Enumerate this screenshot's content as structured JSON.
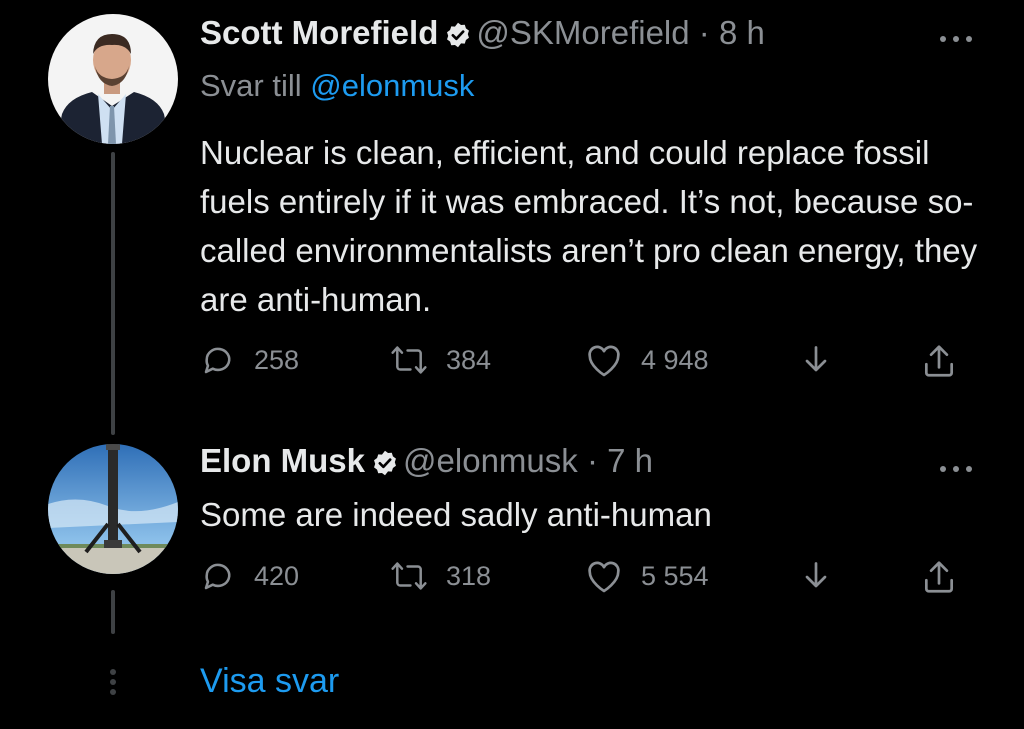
{
  "colors": {
    "background": "#000000",
    "text": "#e7e9ea",
    "muted": "#8b8f94",
    "link": "#1d9bf0",
    "thread_line": "#3e4144"
  },
  "tweets": [
    {
      "name": "Scott Morefield",
      "handle": "@SKMorefield",
      "time": "· 8 h",
      "reply_label": "Svar till",
      "reply_mention": "@elonmusk",
      "text": "Nuclear is clean, efficient, and could replace fossil fuels entirely if it was embraced. It’s not, because so-called environmentalists aren’t pro clean energy, they are anti-human.",
      "replies": "258",
      "retweets": "384",
      "likes": "4 948",
      "more_icon": "more-horizontal-icon",
      "avatar": "profile-photo-man-in-suit"
    },
    {
      "name": "Elon Musk",
      "handle": "@elonmusk",
      "time": "· 7 h",
      "text": "Some are indeed sadly anti-human",
      "replies": "420",
      "retweets": "318",
      "likes": "5 554",
      "more_icon": "more-horizontal-icon",
      "avatar": "profile-photo-rocket-on-landing-pad"
    }
  ],
  "show_replies_label": "Visa svar",
  "icons": [
    "reply-icon",
    "retweet-icon",
    "like-icon",
    "download-icon",
    "share-icon",
    "verified-badge-icon",
    "vertical-dots-icon"
  ]
}
